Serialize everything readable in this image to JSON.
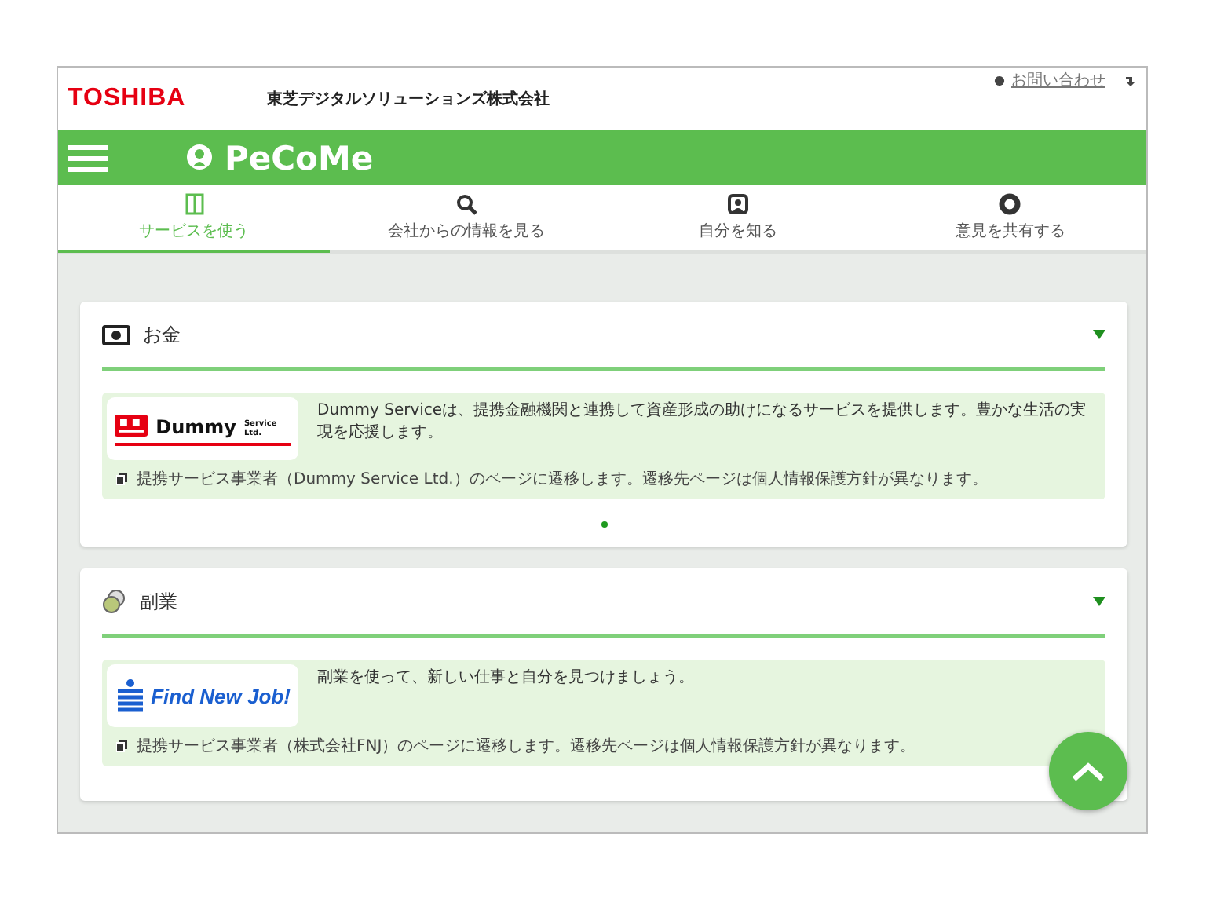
{
  "header": {
    "logo": "TOSHIBA",
    "company": "東芝デジタルソリューションズ株式会社",
    "link": "お問い合わせ"
  },
  "app_bar": {
    "title": "PeCoMe"
  },
  "tabs": [
    {
      "label": "サービスを使う",
      "selected": true,
      "kind": "book"
    },
    {
      "label": "会社からの情報を見る",
      "selected": false,
      "kind": "search"
    },
    {
      "label": "自分を知る",
      "selected": false,
      "kind": "person"
    },
    {
      "label": "意見を共有する",
      "selected": false,
      "kind": "circle"
    }
  ],
  "categories": [
    {
      "kind": "money",
      "title": "お金",
      "expanded": true,
      "services": [
        {
          "logo": {
            "kind": "dummy",
            "name": "Dummy",
            "sub": "Service Ltd."
          },
          "description": "Dummy Serviceは、提携金融機関と連携して資産形成の助けになるサービスを提供します。豊かな生活の実現を応援します。",
          "note": "提携サービス事業者（Dummy Service Ltd.）のページに遷移します。遷移先ページは個人情報保護方針が異なります。"
        }
      ],
      "pager": [
        {
          "selected": true
        }
      ]
    },
    {
      "kind": "side_job",
      "title": "副業",
      "expanded": true,
      "services": [
        {
          "logo": {
            "kind": "findjob",
            "name": "Find New Job!"
          },
          "description": "副業を使って、新しい仕事と自分を見つけましょう。",
          "note": "提携サービス事業者（株式会社FNJ）のページに遷移します。遷移先ページは個人情報保護方針が異なります。"
        }
      ]
    }
  ]
}
